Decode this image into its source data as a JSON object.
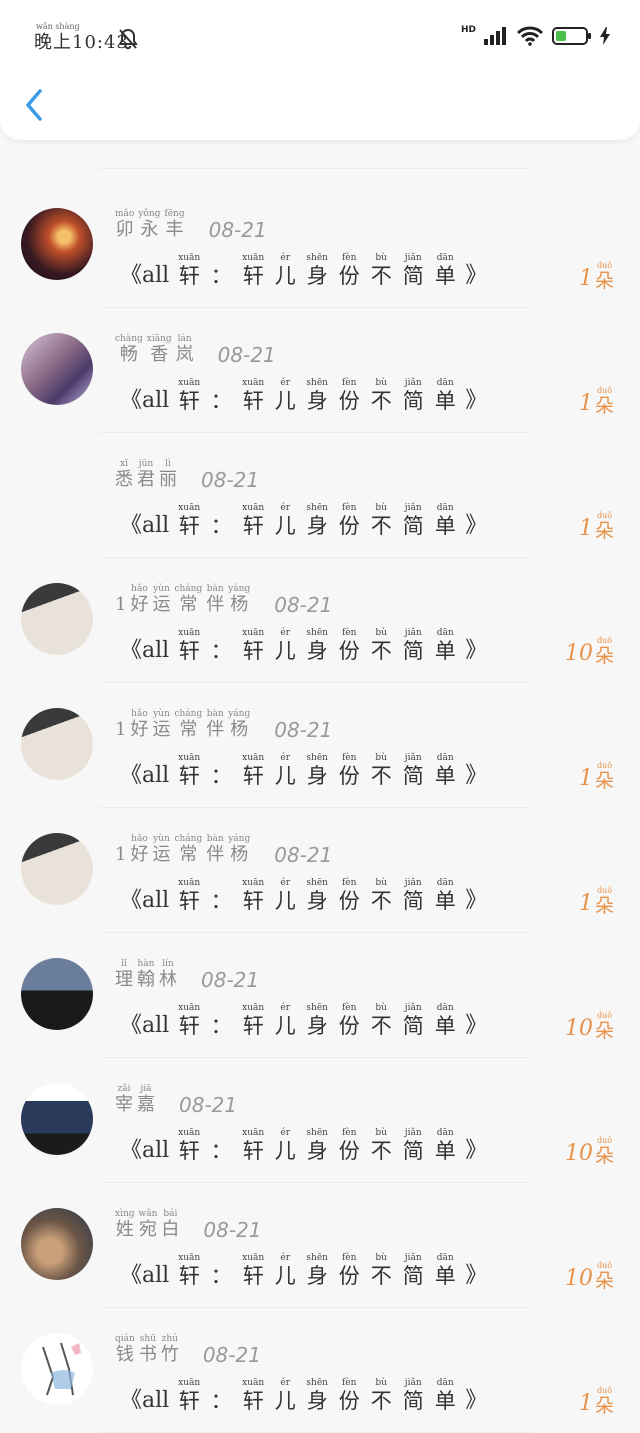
{
  "status_bar": {
    "time_pinyin": "wǎn shàng",
    "time": "晚上10:43",
    "network": "HD",
    "icons": [
      "bell-off-icon",
      "signal-icon",
      "wifi-icon",
      "battery-icon",
      "charging-icon"
    ]
  },
  "header": {
    "back_icon": "chevron-left-icon",
    "accent_color": "#3a9be8"
  },
  "gift_color": "#e8924a",
  "rows": [
    {
      "name": [
        {
          "py": "mǎo",
          "hz": "卯"
        },
        {
          "py": "yǒng",
          "hz": "永"
        },
        {
          "py": "fēng",
          "hz": "丰"
        }
      ],
      "date": "08-21",
      "title_open": "《all",
      "title_chars": [
        {
          "py": "xuān",
          "hz": "轩"
        },
        {
          "py": "",
          "hz": "："
        },
        {
          "py": "xuān",
          "hz": "轩"
        },
        {
          "py": "ér",
          "hz": "儿"
        },
        {
          "py": "shēn",
          "hz": "身"
        },
        {
          "py": "fèn",
          "hz": "份"
        },
        {
          "py": "bù",
          "hz": "不"
        },
        {
          "py": "jiǎn",
          "hz": "简"
        },
        {
          "py": "dān",
          "hz": "单"
        }
      ],
      "title_close": "》",
      "count": "1",
      "unit_py": "duǒ",
      "unit": "朵"
    },
    {
      "name": [
        {
          "py": "chàng",
          "hz": "畅"
        },
        {
          "py": "xiāng",
          "hz": "香"
        },
        {
          "py": "lán",
          "hz": "岚"
        }
      ],
      "date": "08-21",
      "title_open": "《all",
      "title_chars": [
        {
          "py": "xuān",
          "hz": "轩"
        },
        {
          "py": "",
          "hz": "："
        },
        {
          "py": "xuān",
          "hz": "轩"
        },
        {
          "py": "ér",
          "hz": "儿"
        },
        {
          "py": "shēn",
          "hz": "身"
        },
        {
          "py": "fèn",
          "hz": "份"
        },
        {
          "py": "bù",
          "hz": "不"
        },
        {
          "py": "jiǎn",
          "hz": "简"
        },
        {
          "py": "dān",
          "hz": "单"
        }
      ],
      "title_close": "》",
      "count": "1",
      "unit_py": "duǒ",
      "unit": "朵"
    },
    {
      "name": [
        {
          "py": "xī",
          "hz": "悉"
        },
        {
          "py": "jūn",
          "hz": "君"
        },
        {
          "py": "lì",
          "hz": "丽"
        }
      ],
      "date": "08-21",
      "title_open": "《all",
      "title_chars": [
        {
          "py": "xuān",
          "hz": "轩"
        },
        {
          "py": "",
          "hz": "："
        },
        {
          "py": "xuān",
          "hz": "轩"
        },
        {
          "py": "ér",
          "hz": "儿"
        },
        {
          "py": "shēn",
          "hz": "身"
        },
        {
          "py": "fèn",
          "hz": "份"
        },
        {
          "py": "bù",
          "hz": "不"
        },
        {
          "py": "jiǎn",
          "hz": "简"
        },
        {
          "py": "dān",
          "hz": "单"
        }
      ],
      "title_close": "》",
      "count": "1",
      "unit_py": "duǒ",
      "unit": "朵"
    },
    {
      "name": [
        {
          "py": "",
          "hz": "1"
        },
        {
          "py": "hǎo",
          "hz": "好"
        },
        {
          "py": "yùn",
          "hz": "运"
        },
        {
          "py": "cháng",
          "hz": "常"
        },
        {
          "py": "bàn",
          "hz": "伴"
        },
        {
          "py": "yáng",
          "hz": "杨"
        }
      ],
      "date": "08-21",
      "title_open": "《all",
      "title_chars": [
        {
          "py": "xuān",
          "hz": "轩"
        },
        {
          "py": "",
          "hz": "："
        },
        {
          "py": "xuān",
          "hz": "轩"
        },
        {
          "py": "ér",
          "hz": "儿"
        },
        {
          "py": "shēn",
          "hz": "身"
        },
        {
          "py": "fèn",
          "hz": "份"
        },
        {
          "py": "bù",
          "hz": "不"
        },
        {
          "py": "jiǎn",
          "hz": "简"
        },
        {
          "py": "dān",
          "hz": "单"
        }
      ],
      "title_close": "》",
      "count": "10",
      "unit_py": "duǒ",
      "unit": "朵"
    },
    {
      "name": [
        {
          "py": "",
          "hz": "1"
        },
        {
          "py": "hǎo",
          "hz": "好"
        },
        {
          "py": "yùn",
          "hz": "运"
        },
        {
          "py": "cháng",
          "hz": "常"
        },
        {
          "py": "bàn",
          "hz": "伴"
        },
        {
          "py": "yáng",
          "hz": "杨"
        }
      ],
      "date": "08-21",
      "title_open": "《all",
      "title_chars": [
        {
          "py": "xuān",
          "hz": "轩"
        },
        {
          "py": "",
          "hz": "："
        },
        {
          "py": "xuān",
          "hz": "轩"
        },
        {
          "py": "ér",
          "hz": "儿"
        },
        {
          "py": "shēn",
          "hz": "身"
        },
        {
          "py": "fèn",
          "hz": "份"
        },
        {
          "py": "bù",
          "hz": "不"
        },
        {
          "py": "jiǎn",
          "hz": "简"
        },
        {
          "py": "dān",
          "hz": "单"
        }
      ],
      "title_close": "》",
      "count": "1",
      "unit_py": "duǒ",
      "unit": "朵"
    },
    {
      "name": [
        {
          "py": "",
          "hz": "1"
        },
        {
          "py": "hǎo",
          "hz": "好"
        },
        {
          "py": "yùn",
          "hz": "运"
        },
        {
          "py": "cháng",
          "hz": "常"
        },
        {
          "py": "bàn",
          "hz": "伴"
        },
        {
          "py": "yáng",
          "hz": "杨"
        }
      ],
      "date": "08-21",
      "title_open": "《all",
      "title_chars": [
        {
          "py": "xuān",
          "hz": "轩"
        },
        {
          "py": "",
          "hz": "："
        },
        {
          "py": "xuān",
          "hz": "轩"
        },
        {
          "py": "ér",
          "hz": "儿"
        },
        {
          "py": "shēn",
          "hz": "身"
        },
        {
          "py": "fèn",
          "hz": "份"
        },
        {
          "py": "bù",
          "hz": "不"
        },
        {
          "py": "jiǎn",
          "hz": "简"
        },
        {
          "py": "dān",
          "hz": "单"
        }
      ],
      "title_close": "》",
      "count": "1",
      "unit_py": "duǒ",
      "unit": "朵"
    },
    {
      "name": [
        {
          "py": "lǐ",
          "hz": "理"
        },
        {
          "py": "hàn",
          "hz": "翰"
        },
        {
          "py": "lín",
          "hz": "林"
        }
      ],
      "date": "08-21",
      "title_open": "《all",
      "title_chars": [
        {
          "py": "xuān",
          "hz": "轩"
        },
        {
          "py": "",
          "hz": "："
        },
        {
          "py": "xuān",
          "hz": "轩"
        },
        {
          "py": "ér",
          "hz": "儿"
        },
        {
          "py": "shēn",
          "hz": "身"
        },
        {
          "py": "fèn",
          "hz": "份"
        },
        {
          "py": "bù",
          "hz": "不"
        },
        {
          "py": "jiǎn",
          "hz": "简"
        },
        {
          "py": "dān",
          "hz": "单"
        }
      ],
      "title_close": "》",
      "count": "10",
      "unit_py": "duǒ",
      "unit": "朵"
    },
    {
      "name": [
        {
          "py": "zǎi",
          "hz": "宰"
        },
        {
          "py": "jiā",
          "hz": "嘉"
        }
      ],
      "date": "08-21",
      "title_open": "《all",
      "title_chars": [
        {
          "py": "xuān",
          "hz": "轩"
        },
        {
          "py": "",
          "hz": "："
        },
        {
          "py": "xuān",
          "hz": "轩"
        },
        {
          "py": "ér",
          "hz": "儿"
        },
        {
          "py": "shēn",
          "hz": "身"
        },
        {
          "py": "fèn",
          "hz": "份"
        },
        {
          "py": "bù",
          "hz": "不"
        },
        {
          "py": "jiǎn",
          "hz": "简"
        },
        {
          "py": "dān",
          "hz": "单"
        }
      ],
      "title_close": "》",
      "count": "10",
      "unit_py": "duǒ",
      "unit": "朵"
    },
    {
      "name": [
        {
          "py": "xìng",
          "hz": "姓"
        },
        {
          "py": "wǎn",
          "hz": "宛"
        },
        {
          "py": "bái",
          "hz": "白"
        }
      ],
      "date": "08-21",
      "title_open": "《all",
      "title_chars": [
        {
          "py": "xuān",
          "hz": "轩"
        },
        {
          "py": "",
          "hz": "："
        },
        {
          "py": "xuān",
          "hz": "轩"
        },
        {
          "py": "ér",
          "hz": "儿"
        },
        {
          "py": "shēn",
          "hz": "身"
        },
        {
          "py": "fèn",
          "hz": "份"
        },
        {
          "py": "bù",
          "hz": "不"
        },
        {
          "py": "jiǎn",
          "hz": "简"
        },
        {
          "py": "dān",
          "hz": "单"
        }
      ],
      "title_close": "》",
      "count": "10",
      "unit_py": "duǒ",
      "unit": "朵"
    },
    {
      "name": [
        {
          "py": "qián",
          "hz": "钱"
        },
        {
          "py": "shū",
          "hz": "书"
        },
        {
          "py": "zhú",
          "hz": "竹"
        }
      ],
      "date": "08-21",
      "title_open": "《all",
      "title_chars": [
        {
          "py": "xuān",
          "hz": "轩"
        },
        {
          "py": "",
          "hz": "："
        },
        {
          "py": "xuān",
          "hz": "轩"
        },
        {
          "py": "ér",
          "hz": "儿"
        },
        {
          "py": "shēn",
          "hz": "身"
        },
        {
          "py": "fèn",
          "hz": "份"
        },
        {
          "py": "bù",
          "hz": "不"
        },
        {
          "py": "jiǎn",
          "hz": "简"
        },
        {
          "py": "dān",
          "hz": "单"
        }
      ],
      "title_close": "》",
      "count": "1",
      "unit_py": "duǒ",
      "unit": "朵"
    }
  ]
}
